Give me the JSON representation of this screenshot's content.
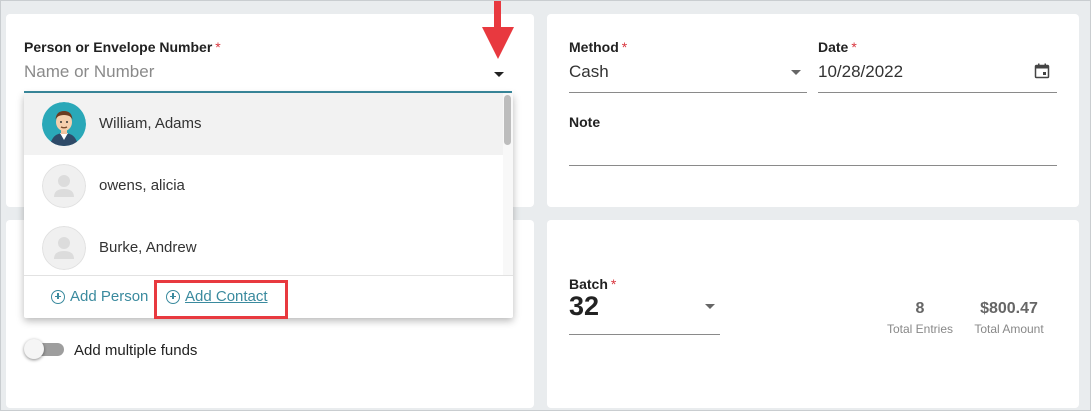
{
  "person_field": {
    "label": "Person or Envelope Number",
    "required_mark": "*",
    "placeholder": "Name or Number",
    "options": [
      {
        "name": "William, Adams",
        "avatar": "male-avatar-icon",
        "selected": true
      },
      {
        "name": "owens, alicia",
        "avatar": "placeholder-avatar-icon",
        "selected": false
      },
      {
        "name": "Burke, Andrew",
        "avatar": "placeholder-avatar-icon",
        "selected": false
      }
    ],
    "add_person_label": "Add Person",
    "add_contact_label": "Add Contact"
  },
  "method_field": {
    "label": "Method",
    "required_mark": "*",
    "value": "Cash"
  },
  "date_field": {
    "label": "Date",
    "required_mark": "*",
    "value": "10/28/2022",
    "icon": "calendar-icon"
  },
  "note_field": {
    "label": "Note",
    "value": ""
  },
  "multiple_funds": {
    "label": "Add multiple funds",
    "enabled": false
  },
  "batch_field": {
    "label": "Batch",
    "required_mark": "*",
    "value": "32"
  },
  "stats": {
    "total_entries_value": "8",
    "total_entries_label": "Total Entries",
    "total_amount_value": "$800.47",
    "total_amount_label": "Total Amount"
  },
  "annotations": {
    "arrow_color": "#e8393f",
    "highlight_color": "#e8393f"
  },
  "colors": {
    "accent": "#3a8a9e",
    "required": "#d9363e"
  }
}
